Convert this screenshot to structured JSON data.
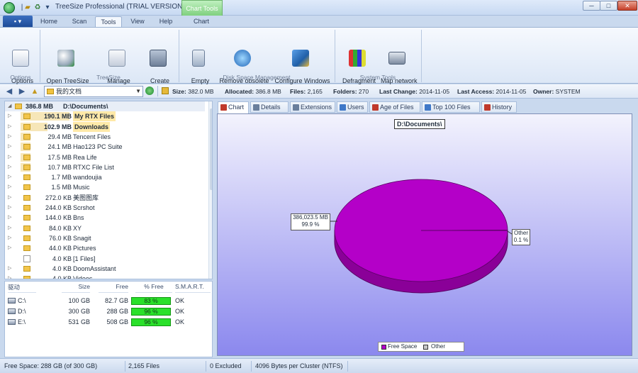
{
  "window": {
    "title": "TreeSize Professional  (TRIAL VERSION)",
    "contextual_tab": "Chart Tools",
    "controls": {
      "minimize": "─",
      "maximize": "□",
      "close": "✕"
    }
  },
  "ribbon": {
    "file_label": "▪ ▾",
    "tabs": [
      {
        "label": "Home"
      },
      {
        "label": "Scan"
      },
      {
        "label": "Tools",
        "active": true
      },
      {
        "label": "View"
      },
      {
        "label": "Help"
      },
      {
        "label": "Chart"
      }
    ],
    "groups": {
      "options": {
        "label": "Options",
        "buttons": [
          {
            "label": "Options\n▾",
            "icon": "options-icon"
          }
        ]
      },
      "treesize": {
        "label": "TreeSize",
        "buttons": [
          {
            "label": "Open TreeSize\nFile Search ▾",
            "icon": "file-search-icon"
          },
          {
            "label": "Manage\nscheduled scans",
            "icon": "scheduled-scans-icon"
          },
          {
            "label": "Create\nsnapshot",
            "icon": "snapshot-icon"
          }
        ]
      },
      "disk_space": {
        "label": "Disk Space Management",
        "buttons": [
          {
            "label": "Empty\nrecycle bin",
            "icon": "recycle-bin-icon"
          },
          {
            "label": "Remove obsolete\nsoftware",
            "icon": "remove-software-icon"
          },
          {
            "label": "Configure Windows\nSystem Restore",
            "icon": "system-restore-icon"
          }
        ]
      },
      "system_tools": {
        "label": "System Tools",
        "buttons": [
          {
            "label": "Defragment\nDisks",
            "icon": "defragment-icon"
          },
          {
            "label": "Map network\ndrive",
            "icon": "network-drive-icon"
          }
        ]
      }
    }
  },
  "addressbar": {
    "back": "◀",
    "forward": "▶",
    "path": "我的文档",
    "dropdown": "▼",
    "stats": {
      "size_label": "Size:",
      "size": "382.0 MB",
      "allocated_label": "Allocated:",
      "allocated": "386.8 MB",
      "files_label": "Files:",
      "files": "2,165",
      "folders_label": "Folders:",
      "folders": "270",
      "last_change_label": "Last Change:",
      "last_change": "2014-11-05",
      "last_access_label": "Last Access:",
      "last_access": "2014-11-05",
      "owner_label": "Owner:",
      "owner": "SYSTEM"
    }
  },
  "tree": {
    "root": {
      "size": "386.8 MB",
      "name": "D:\\Documents\\"
    },
    "items": [
      {
        "size": "190.1 MB",
        "name": "My RTX Files",
        "bar": 0.49,
        "highlight": true
      },
      {
        "size": "102.9 MB",
        "name": "Downloads",
        "bar": 0.27,
        "highlight": true
      },
      {
        "size": "29.4 MB",
        "name": "Tencent Files",
        "bar": 0.08
      },
      {
        "size": "24.1 MB",
        "name": "Hao123 PC Suite",
        "bar": 0.06
      },
      {
        "size": "17.5 MB",
        "name": "Rea Life",
        "bar": 0.05
      },
      {
        "size": "10.7 MB",
        "name": "RTXC File List",
        "bar": 0.03
      },
      {
        "size": "1.7 MB",
        "name": "wandoujia",
        "bar": 0.01
      },
      {
        "size": "1.5 MB",
        "name": "Music",
        "bar": 0.01
      },
      {
        "size": "272.0 KB",
        "name": "美图图库",
        "bar": 0
      },
      {
        "size": "244.0 KB",
        "name": "Scrshot",
        "bar": 0
      },
      {
        "size": "144.0 KB",
        "name": "Bns",
        "bar": 0
      },
      {
        "size": "84.0 KB",
        "name": "XY",
        "bar": 0
      },
      {
        "size": "76.0 KB",
        "name": "Snagit",
        "bar": 0
      },
      {
        "size": "44.0 KB",
        "name": "Pictures",
        "bar": 0
      },
      {
        "size": "4.0 KB",
        "name": "[1 Files]",
        "bar": 0,
        "file": true
      },
      {
        "size": "4.0 KB",
        "name": "DoomAssistant",
        "bar": 0
      },
      {
        "size": "4.0 KB",
        "name": "Videos",
        "bar": 0
      }
    ]
  },
  "drives": {
    "headers": {
      "drive": "驱动",
      "size": "Size",
      "free": "Free",
      "pct_free": "% Free",
      "smart": "S.M.A.R.T."
    },
    "rows": [
      {
        "drive": "C:\\",
        "size": "100 GB",
        "free": "82.7 GB",
        "pct": "83 %",
        "smart": "OK"
      },
      {
        "drive": "D:\\",
        "size": "300 GB",
        "free": "288 GB",
        "pct": "96 %",
        "smart": "OK"
      },
      {
        "drive": "E:\\",
        "size": "531 GB",
        "free": "508 GB",
        "pct": "96 %",
        "smart": "OK"
      }
    ]
  },
  "chart_tabs": [
    {
      "label": "Chart",
      "active": true
    },
    {
      "label": "Details"
    },
    {
      "label": "Extensions"
    },
    {
      "label": "Users"
    },
    {
      "label": "Age of Files"
    },
    {
      "label": "Top 100 Files"
    },
    {
      "label": "History"
    }
  ],
  "chart_data": {
    "type": "pie",
    "title": "D:\\Documents\\",
    "slices": [
      {
        "name": "Free Space",
        "value": 99.9,
        "label": "386,023.5 MB\n99.9 %",
        "color": "#b400c8"
      },
      {
        "name": "Other",
        "value": 0.1,
        "label": "Other\n0.1 %",
        "color": "#c8c8c8"
      }
    ],
    "legend": [
      "Free Space",
      "Other"
    ],
    "legend_position": "bottom"
  },
  "statusbar": {
    "free_space": "Free Space: 288 GB  (of 300 GB)",
    "files": "2,165  Files",
    "excluded": "0 Excluded",
    "cluster": "4096 Bytes per Cluster (NTFS)"
  }
}
